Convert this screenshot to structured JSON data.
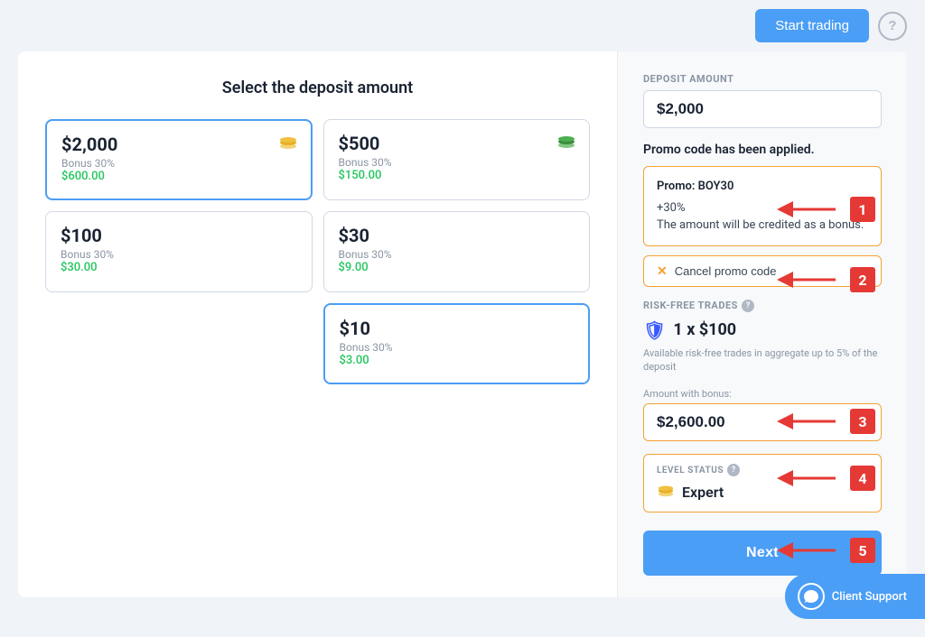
{
  "header": {
    "start_trading_label": "Start trading",
    "help_icon": "?"
  },
  "left_panel": {
    "title": "Select the deposit amount",
    "deposit_cards": [
      {
        "amount": "$2,000",
        "bonus_label": "Bonus 30%",
        "bonus_value": "$600.00",
        "selected": true,
        "icon": "stack-gold"
      },
      {
        "amount": "$500",
        "bonus_label": "Bonus 30%",
        "bonus_value": "$150.00",
        "selected": false,
        "icon": "stack-green"
      },
      {
        "amount": "$100",
        "bonus_label": "Bonus 30%",
        "bonus_value": "$30.00",
        "selected": false,
        "icon": ""
      },
      {
        "amount": "$30",
        "bonus_label": "Bonus 30%",
        "bonus_value": "$9.00",
        "selected": false,
        "icon": ""
      },
      {
        "amount": "$10",
        "bonus_label": "Bonus 30%",
        "bonus_value": "$3.00",
        "selected": true,
        "icon": ""
      }
    ]
  },
  "right_panel": {
    "deposit_amount_label": "DEPOSIT AMOUNT",
    "deposit_amount_value": "$2,000",
    "promo_applied_text": "Promo code has been applied.",
    "promo_code_line": "Promo: BOY30",
    "promo_bonus_percent": "+30%",
    "promo_description": "The amount will be credited as a bonus.",
    "cancel_promo_label": "Cancel promo code",
    "risk_free_label": "RISK-FREE TRADES",
    "risk_free_value": "1 x $100",
    "risk_free_note": "Available risk-free trades in aggregate up to 5% of the deposit",
    "amount_bonus_label": "Amount with bonus:",
    "amount_bonus_value": "$2,600.00",
    "level_status_label": "LEVEL STATUS",
    "level_value": "Expert",
    "next_button_label": "Next"
  },
  "annotations": {
    "items": [
      {
        "number": "1"
      },
      {
        "number": "2"
      },
      {
        "number": "3"
      },
      {
        "number": "4"
      },
      {
        "number": "5"
      }
    ]
  },
  "client_support": {
    "label": "Client Support"
  }
}
